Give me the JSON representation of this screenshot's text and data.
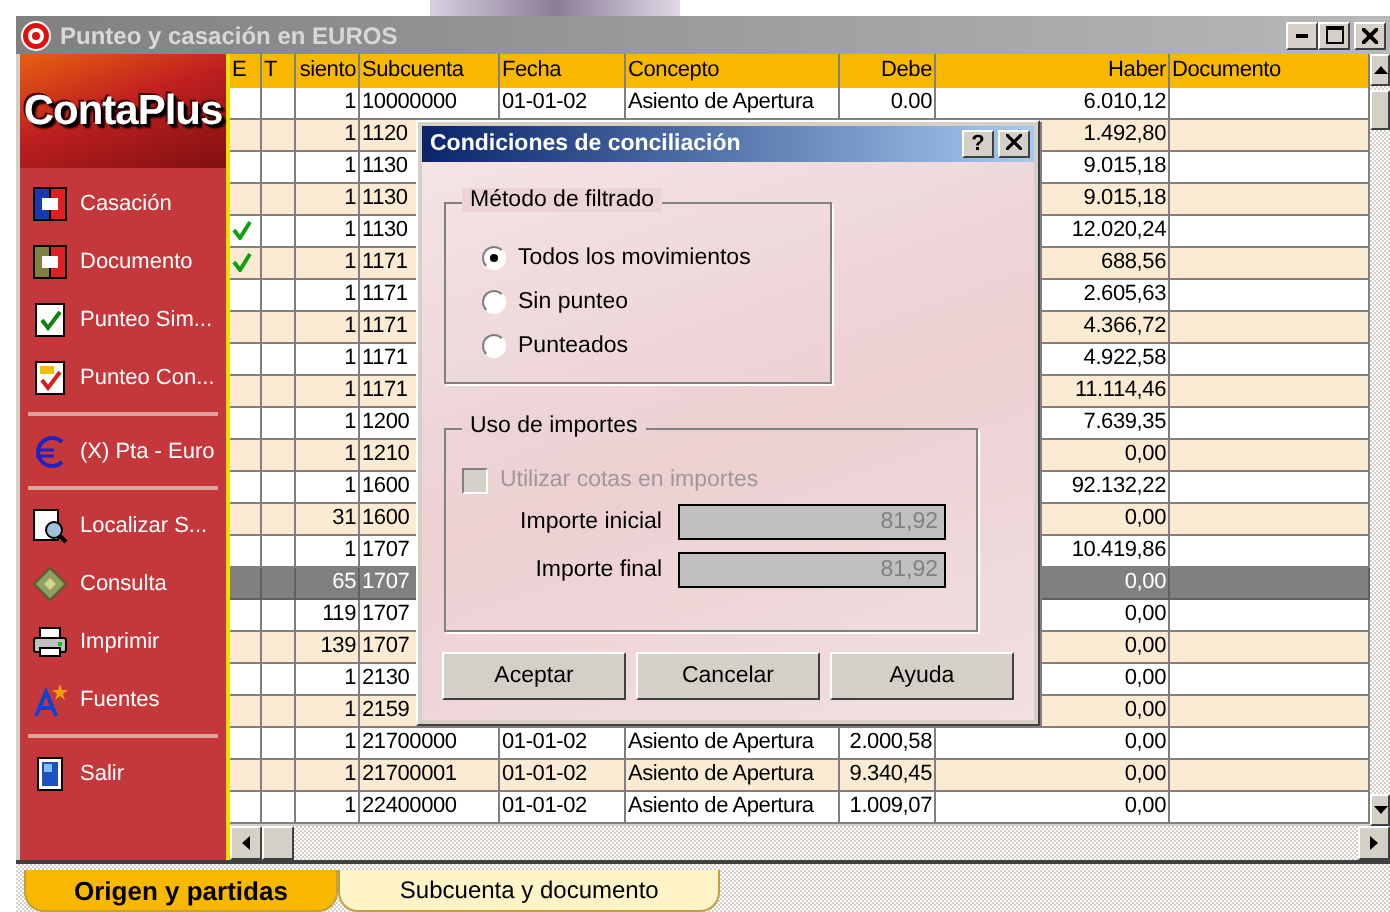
{
  "window": {
    "title": "Punteo y casación en EUROS"
  },
  "sidebar": {
    "logo": "ContaPlus",
    "groups": [
      [
        {
          "label": "Casación",
          "kind": "casacion"
        },
        {
          "label": "Documento",
          "kind": "documento"
        },
        {
          "label": "Punteo Sim...",
          "kind": "punteo"
        },
        {
          "label": "Punteo Con...",
          "kind": "punteo2"
        }
      ],
      [
        {
          "label": "(X) Pta - Euro",
          "kind": "euro"
        }
      ],
      [
        {
          "label": "Localizar S...",
          "kind": "localizar"
        },
        {
          "label": "Consulta",
          "kind": "consulta"
        },
        {
          "label": "Imprimir",
          "kind": "imprimir"
        },
        {
          "label": "Fuentes",
          "kind": "fuentes"
        }
      ],
      [
        {
          "label": "Salir",
          "kind": "salir"
        }
      ]
    ]
  },
  "table": {
    "columns": [
      "E",
      "T",
      "siento",
      "Subcuenta",
      "Fecha",
      "Concepto",
      "Debe",
      "Haber",
      "Documento"
    ],
    "rows": [
      {
        "checked": false,
        "selected": false,
        "asiento": "1",
        "subcuenta": "10000000",
        "fecha": "01-01-02",
        "concepto": "Asiento de Apertura",
        "debe": "0.00",
        "haber": "6.010,12"
      },
      {
        "checked": false,
        "selected": false,
        "asiento": "1",
        "subcuenta": "1120",
        "haber": "1.492,80"
      },
      {
        "checked": false,
        "selected": false,
        "asiento": "1",
        "subcuenta": "1130",
        "haber": "9.015,18"
      },
      {
        "checked": false,
        "selected": false,
        "asiento": "1",
        "subcuenta": "1130",
        "haber": "9.015,18"
      },
      {
        "checked": true,
        "selected": false,
        "asiento": "1",
        "subcuenta": "1130",
        "haber": "12.020,24"
      },
      {
        "checked": true,
        "selected": false,
        "asiento": "1",
        "subcuenta": "1171",
        "haber": "688,56"
      },
      {
        "checked": false,
        "selected": false,
        "asiento": "1",
        "subcuenta": "1171",
        "haber": "2.605,63"
      },
      {
        "checked": false,
        "selected": false,
        "asiento": "1",
        "subcuenta": "1171",
        "haber": "4.366,72"
      },
      {
        "checked": false,
        "selected": false,
        "asiento": "1",
        "subcuenta": "1171",
        "haber": "4.922,58"
      },
      {
        "checked": false,
        "selected": false,
        "asiento": "1",
        "subcuenta": "1171",
        "haber": "11.114,46"
      },
      {
        "checked": false,
        "selected": false,
        "asiento": "1",
        "subcuenta": "1200",
        "haber": "7.639,35"
      },
      {
        "checked": false,
        "selected": false,
        "asiento": "1",
        "subcuenta": "1210",
        "haber": "0,00"
      },
      {
        "checked": false,
        "selected": false,
        "asiento": "1",
        "subcuenta": "1600",
        "haber": "92.132,22"
      },
      {
        "checked": false,
        "selected": false,
        "asiento": "31",
        "subcuenta": "1600",
        "haber": "0,00"
      },
      {
        "checked": false,
        "selected": false,
        "asiento": "1",
        "subcuenta": "1707",
        "haber": "10.419,86"
      },
      {
        "checked": false,
        "selected": true,
        "asiento": "65",
        "subcuenta": "1707",
        "haber": "0,00"
      },
      {
        "checked": false,
        "selected": false,
        "asiento": "119",
        "subcuenta": "1707",
        "haber": "0,00"
      },
      {
        "checked": false,
        "selected": false,
        "asiento": "139",
        "subcuenta": "1707",
        "haber": "0,00"
      },
      {
        "checked": false,
        "selected": false,
        "asiento": "1",
        "subcuenta": "2130",
        "haber": "0,00"
      },
      {
        "checked": false,
        "selected": false,
        "asiento": "1",
        "subcuenta": "2159",
        "haber": "0,00"
      },
      {
        "checked": false,
        "selected": false,
        "asiento": "1",
        "subcuenta": "21700000",
        "fecha": "01-01-02",
        "concepto": "Asiento de Apertura",
        "debe": "2.000,58",
        "haber": "0,00"
      },
      {
        "checked": false,
        "selected": false,
        "asiento": "1",
        "subcuenta": "21700001",
        "fecha": "01-01-02",
        "concepto": "Asiento de Apertura",
        "debe": "9.340,45",
        "haber": "0,00"
      },
      {
        "checked": false,
        "selected": false,
        "asiento": "1",
        "subcuenta": "22400000",
        "fecha": "01-01-02",
        "concepto": "Asiento de Apertura",
        "debe": "1.009,07",
        "haber": "0,00"
      }
    ]
  },
  "dialog": {
    "title": "Condiciones de conciliación",
    "help": "?",
    "filter_group": {
      "title": "Método de filtrado",
      "options": [
        {
          "label": "Todos los movimientos",
          "selected": true
        },
        {
          "label": "Sin punteo",
          "selected": false
        },
        {
          "label": "Punteados",
          "selected": false
        }
      ]
    },
    "amount_group": {
      "title": "Uso de importes",
      "checkbox": {
        "label": "Utilizar cotas en importes",
        "checked": false,
        "disabled": true
      },
      "fields": [
        {
          "label": "Importe inicial",
          "value": "81,92"
        },
        {
          "label": "Importe final",
          "value": "81,92"
        }
      ]
    },
    "buttons": [
      "Aceptar",
      "Cancelar",
      "Ayuda"
    ]
  },
  "tabs": [
    {
      "label": "Origen y partidas",
      "selected": true
    },
    {
      "label": "Subcuenta y documento",
      "selected": false
    }
  ]
}
